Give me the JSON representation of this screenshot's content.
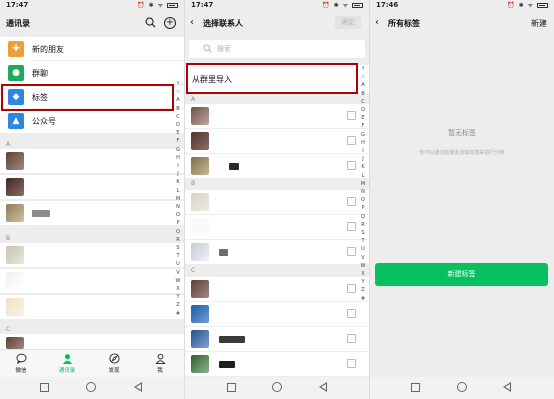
{
  "panel1": {
    "status_time": "17:47",
    "status_icons": "⏰ ✱ ᯤ",
    "title": "通讯录",
    "nav_items": [
      {
        "label": "新的朋友",
        "color": "#f29d38",
        "glyph": "👤"
      },
      {
        "label": "群聊",
        "color": "#1aad5c",
        "glyph": "👥"
      },
      {
        "label": "标签",
        "color": "#2d86e0",
        "glyph": "🏷"
      },
      {
        "label": "公众号",
        "color": "#2d86e0",
        "glyph": "👤"
      }
    ],
    "section_a": "A",
    "section_b": "B",
    "section_c": "C",
    "index_letters": [
      "↑",
      "☆",
      "A",
      "B",
      "C",
      "D",
      "E",
      "F",
      "G",
      "H",
      "I",
      "J",
      "K",
      "L",
      "M",
      "N",
      "O",
      "P",
      "Q",
      "R",
      "S",
      "T",
      "U",
      "V",
      "W",
      "X",
      "Y",
      "Z",
      "#"
    ],
    "tabs": [
      {
        "label": "微信",
        "icon": "chat-icon"
      },
      {
        "label": "通讯录",
        "icon": "contacts-icon"
      },
      {
        "label": "发现",
        "icon": "compass-icon"
      },
      {
        "label": "我",
        "icon": "person-icon"
      }
    ]
  },
  "panel2": {
    "status_time": "17:47",
    "status_icons": "⏰ ✱ ᯤ",
    "back_glyph": "‹",
    "title": "选择联系人",
    "confirm_label": "确定",
    "search_placeholder": "搜索",
    "import_label": "从群里导入",
    "section_a": "A",
    "section_b": "B",
    "section_c": "C",
    "index_letters": [
      "↑",
      "☆",
      "A",
      "B",
      "C",
      "D",
      "E",
      "F",
      "G",
      "H",
      "I",
      "J",
      "K",
      "L",
      "M",
      "N",
      "O",
      "P",
      "Q",
      "R",
      "S",
      "T",
      "U",
      "V",
      "W",
      "X",
      "Y",
      "Z",
      "#"
    ]
  },
  "panel3": {
    "status_time": "17:46",
    "status_icons": "⏰ ✱ ᯤ",
    "back_glyph": "‹",
    "title": "所有标签",
    "new_label": "新建",
    "empty_title": "暂无标签",
    "empty_sub": "你可以通过给朋友添加标签来进行分类",
    "new_tag_button": "新建标签"
  },
  "colors": {
    "accent_green": "#07c160",
    "highlight_red": "#b00000",
    "background": "#ededed"
  }
}
